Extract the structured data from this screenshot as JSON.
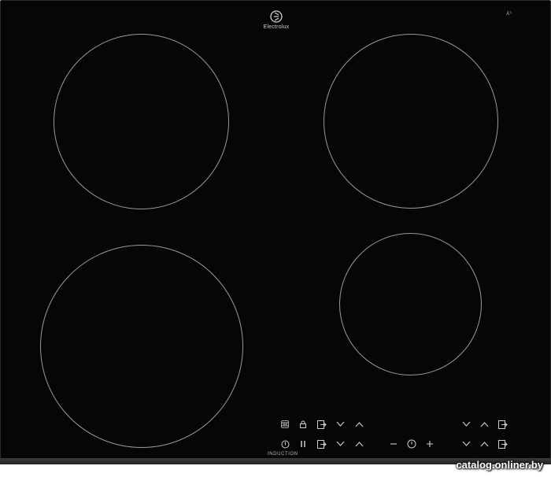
{
  "brand": {
    "name": "Electrolux",
    "logo_icon": "electrolux-logo-icon"
  },
  "corner_mark": "⅄⁵",
  "label_induction": "INDUCTION",
  "watermark": "catalog.onliner.by",
  "cooking_zones": [
    "front-left",
    "rear-left",
    "rear-right",
    "front-right"
  ],
  "controls": {
    "top_row": [
      "hob2hood-icon",
      "lock-icon",
      "zone-select-icon",
      "chevron-down-icon",
      "chevron-up-icon",
      "chevron-down-icon",
      "chevron-up-icon",
      "zone-select-icon"
    ],
    "bottom_row": [
      "power-icon",
      "pause-icon",
      "zone-select-icon",
      "chevron-down-icon",
      "chevron-up-icon",
      "minus-icon",
      "timer-icon",
      "plus-icon",
      "chevron-down-icon",
      "chevron-up-icon",
      "zone-select-icon"
    ]
  },
  "colors": {
    "glass": "#060606",
    "print": "#cfcfcf",
    "zone_outline": "#9a9a9a"
  }
}
